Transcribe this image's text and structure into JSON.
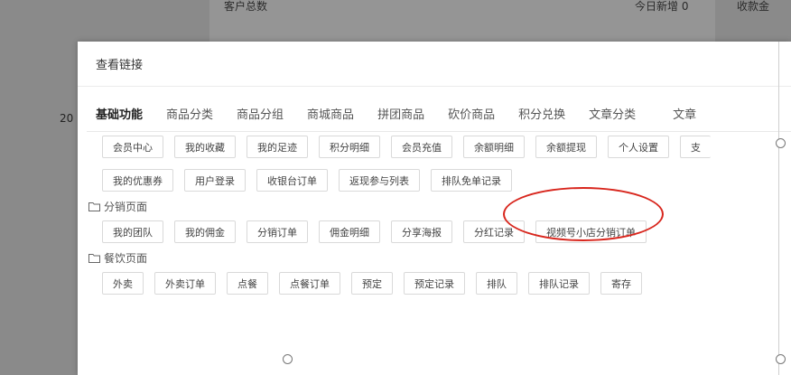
{
  "background": {
    "customer_total_label": "客户总数",
    "today_new_label": "今日新增 0",
    "receipt_label": "收款金",
    "left_number": "20"
  },
  "modal": {
    "title": "查看链接",
    "tabs": [
      {
        "label": "基础功能"
      },
      {
        "label": "商品分类"
      },
      {
        "label": "商品分组"
      },
      {
        "label": "商城商品"
      },
      {
        "label": "拼团商品"
      },
      {
        "label": "砍价商品"
      },
      {
        "label": "积分兑换"
      },
      {
        "label": "文章分类"
      },
      {
        "label": "文章"
      }
    ],
    "basic_row1": [
      "会员中心",
      "我的收藏",
      "我的足迹",
      "积分明细",
      "会员充值",
      "余额明细",
      "余额提现",
      "个人设置",
      "支"
    ],
    "basic_row2": [
      "我的优惠券",
      "用户登录",
      "收银台订单",
      "返现参与列表",
      "排队免单记录"
    ],
    "distribution_title": "分销页面",
    "distribution_row": [
      "我的团队",
      "我的佣金",
      "分销订单",
      "佣金明细",
      "分享海报",
      "分红记录",
      "视频号小店分销订单"
    ],
    "catering_title": "餐饮页面",
    "catering_row": [
      "外卖",
      "外卖订单",
      "点餐",
      "点餐订单",
      "预定",
      "预定记录",
      "排队",
      "排队记录",
      "寄存"
    ]
  }
}
